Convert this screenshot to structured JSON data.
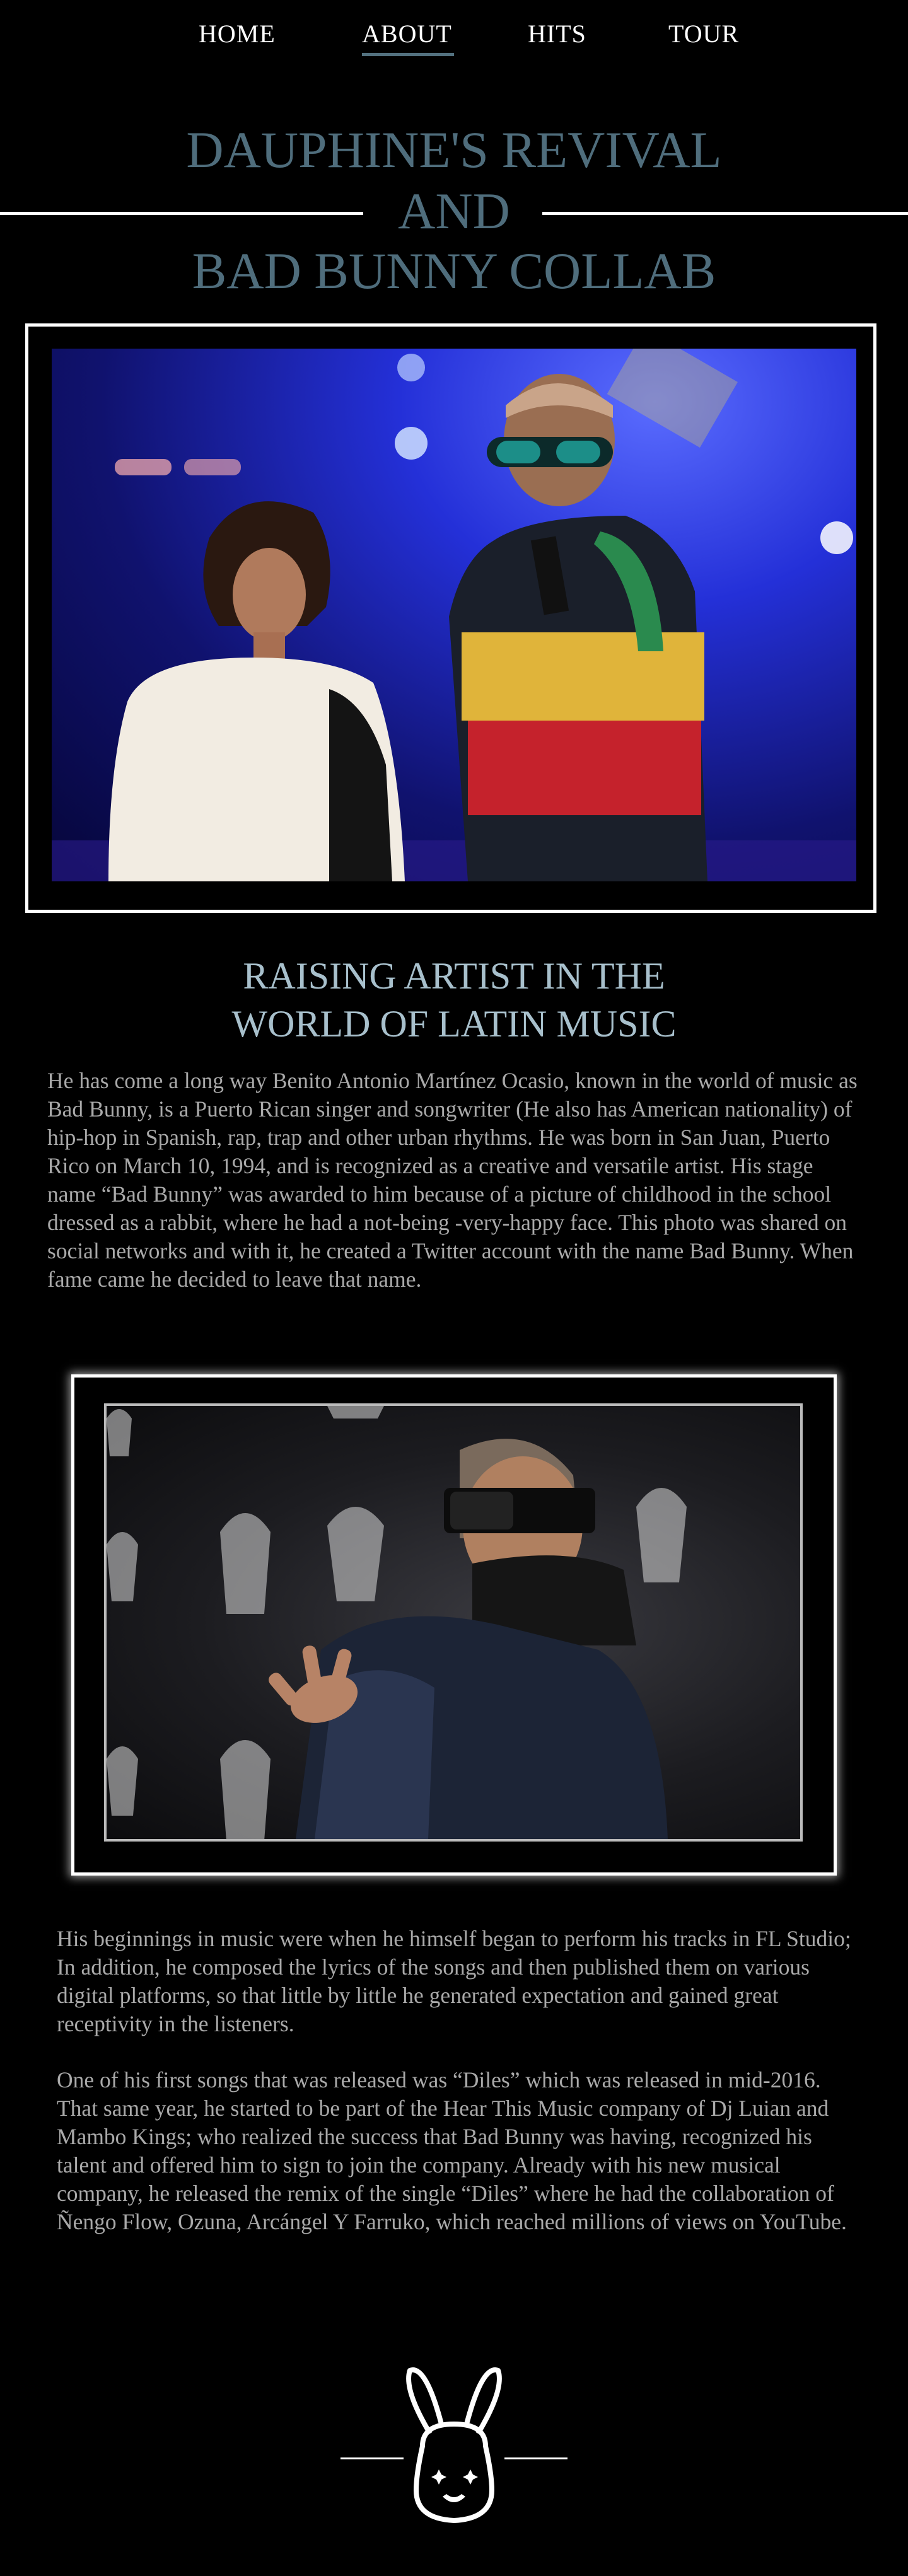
{
  "nav": {
    "items": [
      {
        "label": "HOME"
      },
      {
        "label": "ABOUT"
      },
      {
        "label": "HITS"
      },
      {
        "label": "TOUR"
      }
    ],
    "active": "ABOUT",
    "accent_color": "#52707e"
  },
  "title": {
    "line1": "DAUPHINE'S REVIVAL",
    "line2": "AND",
    "line3": "BAD BUNNY COLLAB",
    "color": "#4f6d7c"
  },
  "subtitle": {
    "line1": "RAISING ARTIST IN THE",
    "line2": "WORLD OF LATIN MUSIC",
    "color": "#a8c0cc"
  },
  "images": {
    "concert_photo": "two performers on a blue-lit stage",
    "portrait_photo": "artist in sunglasses and dark velvet jacket"
  },
  "paragraphs": [
    "He has come a long way Benito Antonio Martínez Ocasio, known in the world of music as Bad Bunny, is a Puerto Rican singer and songwriter (He also has American nationality) of hip-hop in Spanish, rap, trap and other urban rhythms. He was born in San Juan, Puerto Rico on March 10, 1994, and is recognized as a creative and versatile artist. His stage name “Bad Bunny” was awarded to him because of a picture of childhood in the school dressed as a rabbit, where he had a not-being -very-happy face. This photo was shared on social networks and with it, he created a Twitter account with the name Bad Bunny. When fame came he decided to leave that name.",
    "His beginnings in music were when he himself began to perform his tracks in FL Studio; In addition, he composed the lyrics of the songs and then published them on various digital platforms, so that little by little he generated expectation and gained great receptivity in the listeners.",
    "One of his first songs that was released was “Diles” which was released in mid-2016. That same year, he started to be part of the Hear This Music company of Dj Luian and Mambo Kings; who realized the success that Bad Bunny was having, recognized his talent and offered him to sign to join the company. Already with his new musical company, he released the remix of the single “Diles” where he had the collaboration of Ñengo Flow, Ozuna, Arcángel Y Farruko, which reached millions of views on YouTube."
  ],
  "footer": {
    "logo_icon": "bunny-logo-icon"
  }
}
